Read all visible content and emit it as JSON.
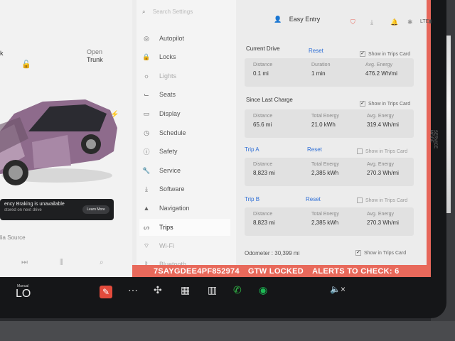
{
  "car": {
    "frunk_label": "k",
    "trunk_label_line1": "Open",
    "trunk_label_line2": "Trunk",
    "alert_title": "ency Braking is unavailable",
    "alert_sub": "stored on next drive",
    "learn_more": "Learn More",
    "media_source": "lia Source"
  },
  "menu": {
    "search_placeholder": "Search Settings",
    "items": [
      {
        "label": "Autopilot"
      },
      {
        "label": "Locks"
      },
      {
        "label": "Lights"
      },
      {
        "label": "Seats"
      },
      {
        "label": "Display"
      },
      {
        "label": "Schedule"
      },
      {
        "label": "Safety"
      },
      {
        "label": "Service"
      },
      {
        "label": "Software"
      },
      {
        "label": "Navigation"
      },
      {
        "label": "Trips"
      },
      {
        "label": "Wi-Fi"
      },
      {
        "label": "Bluetooth"
      }
    ]
  },
  "topbar": {
    "profile": "Easy Entry"
  },
  "trips": {
    "show_label": "Show in Trips Card",
    "reset_label": "Reset",
    "current": {
      "title": "Current Drive",
      "distance_k": "Distance",
      "distance_v": "0.1 mi",
      "duration_k": "Duration",
      "duration_v": "1 min",
      "energy_k": "Avg. Energy",
      "energy_v": "476.2 Wh/mi"
    },
    "since_charge": {
      "title": "Since Last Charge",
      "distance_k": "Distance",
      "distance_v": "65.6 mi",
      "total_k": "Total Energy",
      "total_v": "21.0 kWh",
      "energy_k": "Avg. Energy",
      "energy_v": "319.4 Wh/mi"
    },
    "trip_a": {
      "title": "Trip A",
      "distance_k": "Distance",
      "distance_v": "8,823 mi",
      "total_k": "Total Energy",
      "total_v": "2,385 kWh",
      "energy_k": "Avg. Energy",
      "energy_v": "270.3 Wh/mi"
    },
    "trip_b": {
      "title": "Trip B",
      "distance_k": "Distance",
      "distance_v": "8,823 mi",
      "total_k": "Total Energy",
      "total_v": "2,385 kWh",
      "energy_k": "Avg. Energy",
      "energy_v": "270.3 Wh/mi"
    },
    "odometer": "Odometer : 30,399 mi"
  },
  "status": {
    "vin": "7SAYGDEE4PF852974",
    "gtw": "GTW LOCKED",
    "alerts": "ALERTS TO CHECK: 6"
  },
  "dock": {
    "gear_label": "Manual",
    "gear_value": "LO",
    "vertical_label": "SERVICE MODE"
  },
  "colors": {
    "accent_red": "#e7665a",
    "link_blue": "#2f6fd6",
    "car_paint": "#8e6b8c"
  }
}
